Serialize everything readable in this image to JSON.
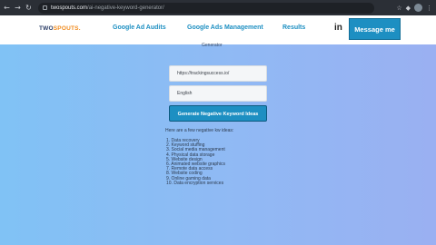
{
  "browser": {
    "url_host": "twospouts.com",
    "url_path": "/ai-negative-keyword-generator/"
  },
  "header": {
    "logo_main": "TWO",
    "logo_accent": "SPOUTS.",
    "nav": [
      {
        "label": "Google Ad Audits"
      },
      {
        "label": "Google Ads Management"
      },
      {
        "label": "Results"
      }
    ],
    "linkedin_label": "in",
    "message_button": "Message me"
  },
  "main": {
    "partial_text": "Generator",
    "url_field_value": "https://trackingsuccess.io/",
    "language_field_value": "English",
    "generate_button": "Generate Negative Keyword Ideas",
    "intro_text": "Here are a few negative kw ideas:",
    "ideas": [
      "1. Data recovery",
      "2. Keyword stuffing",
      "3. Social media management",
      "4. Physical data storage",
      "5. Website design",
      "6. Animated website graphics",
      "7. Remote data access",
      "8. Website coding",
      "9. Online gaming data",
      "10. Data encryption services"
    ]
  }
}
